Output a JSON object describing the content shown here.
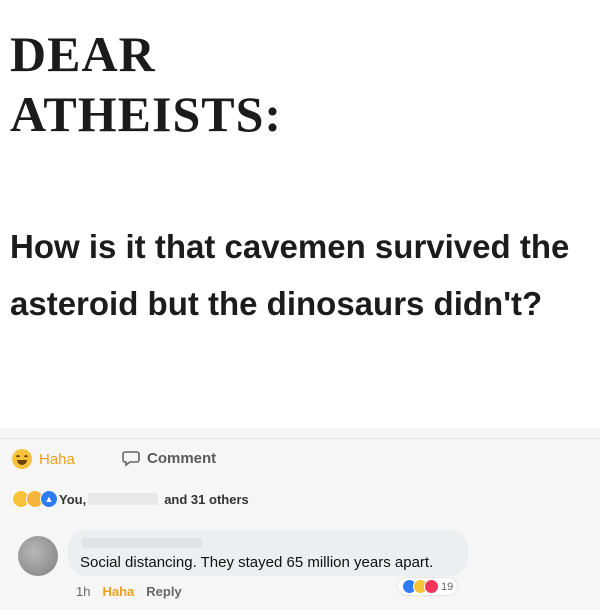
{
  "post": {
    "heading_line1": "DEAR",
    "heading_line2": "ATHEISTS:",
    "question": "How is it that cavemen survived the asteroid but the dinosaurs didn't?"
  },
  "actions": {
    "haha_label": "Haha",
    "comment_label": "Comment"
  },
  "reactions": {
    "you": "You,",
    "others": "and 31 others"
  },
  "comment": {
    "text": "Social distancing. They stayed 65 million years apart.",
    "time": "1h",
    "haha_label": "Haha",
    "reply_label": "Reply",
    "reaction_count": "19"
  },
  "colors": {
    "haha": "#e7a11e",
    "like": "#2d7df6",
    "love": "#f0365a"
  }
}
